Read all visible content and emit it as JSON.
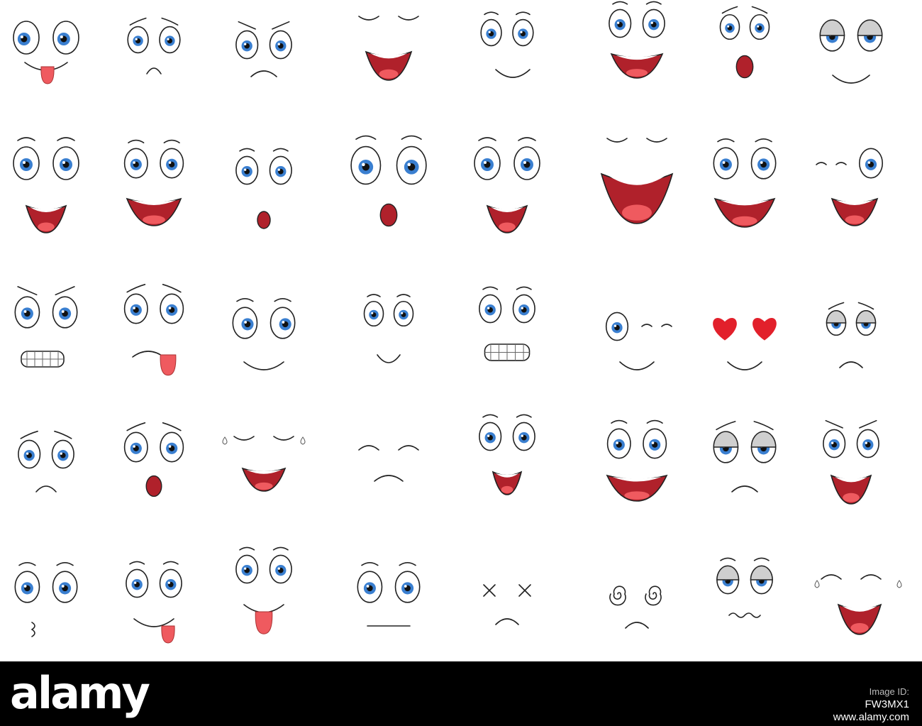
{
  "colors": {
    "iris": "#3a7fd0",
    "mouth": "#b0212b",
    "tongue": "#ef5a5f",
    "heart": "#e2202b",
    "lid": "#cfcfcf",
    "footer": "#000000"
  },
  "faces": [
    "tongue",
    "worried",
    "grumpy",
    "eyes-closed-laugh",
    "smirk",
    "happy",
    "shocked",
    "tired-smile",
    "happy-open",
    "grin",
    "surprised-o",
    "amazed",
    "happy-open",
    "laughing",
    "big-grin",
    "wink-grin",
    "gritted-teeth",
    "silly-tongue",
    "cross-eyed-smile",
    "content",
    "toothy-grin",
    "wink-smile",
    "in-love",
    "sad-tired",
    "sad",
    "confused-tongue",
    "crying-shout",
    "sad-closed",
    "cheerful",
    "excited",
    "sleepy-sad",
    "evil-grin",
    "kissy",
    "playful-tongue",
    "tongue-out",
    "neutral",
    "knocked-out",
    "dizzy",
    "nervous",
    "sobbing"
  ],
  "footer": {
    "logo": "alamy",
    "image_id_label": "Image ID:",
    "image_id": "FW3MX1",
    "site": "www.alamy.com"
  }
}
